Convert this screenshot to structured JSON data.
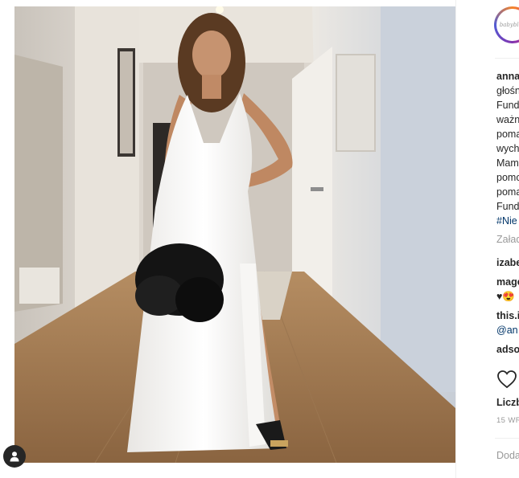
{
  "post": {
    "author_username": "anna",
    "avatar_caption": "babyblue",
    "caption_lines": [
      "głośn",
      "Fund",
      "ważn",
      "poma",
      "wych",
      "Mam",
      "pomo",
      "poma",
      "Fund"
    ],
    "hashtag": "#Nie",
    "load_more_label": "Załad",
    "comments": [
      {
        "user": "izabe",
        "text": ""
      },
      {
        "user": "mage",
        "text": "♥😍"
      },
      {
        "user": "this.i",
        "mention": "@an"
      },
      {
        "user": "adso",
        "text": ""
      }
    ],
    "likes_label": "Liczb",
    "timestamp": "15 WR",
    "add_comment_placeholder": "Doda"
  },
  "icons": {
    "like": "heart-icon",
    "tagged_user": "user-icon"
  },
  "colors": {
    "link": "#003569",
    "muted": "#999999",
    "text": "#262626"
  }
}
